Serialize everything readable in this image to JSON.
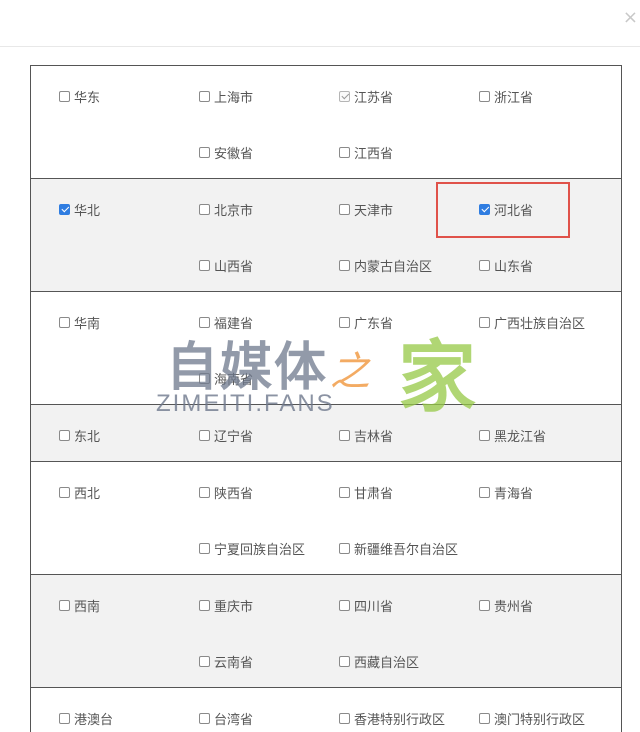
{
  "dialog": {
    "close_symbol": "×"
  },
  "regions": [
    {
      "name": "华东",
      "checked": false,
      "provinces": [
        {
          "label": "上海市",
          "state": "unchecked"
        },
        {
          "label": "江苏省",
          "state": "disabled-checked"
        },
        {
          "label": "浙江省",
          "state": "unchecked"
        },
        {
          "label": "安徽省",
          "state": "unchecked"
        },
        {
          "label": "江西省",
          "state": "unchecked"
        }
      ]
    },
    {
      "name": "华北",
      "checked": true,
      "provinces": [
        {
          "label": "北京市",
          "state": "unchecked"
        },
        {
          "label": "天津市",
          "state": "unchecked"
        },
        {
          "label": "河北省",
          "state": "checked"
        },
        {
          "label": "山西省",
          "state": "unchecked"
        },
        {
          "label": "内蒙古自治区",
          "state": "unchecked"
        },
        {
          "label": "山东省",
          "state": "unchecked"
        }
      ]
    },
    {
      "name": "华南",
      "checked": false,
      "provinces": [
        {
          "label": "福建省",
          "state": "unchecked"
        },
        {
          "label": "广东省",
          "state": "unchecked"
        },
        {
          "label": "广西壮族自治区",
          "state": "unchecked"
        },
        {
          "label": "海南省",
          "state": "unchecked"
        }
      ]
    },
    {
      "name": "东北",
      "checked": false,
      "provinces": [
        {
          "label": "辽宁省",
          "state": "unchecked"
        },
        {
          "label": "吉林省",
          "state": "unchecked"
        },
        {
          "label": "黑龙江省",
          "state": "unchecked"
        }
      ]
    },
    {
      "name": "西北",
      "checked": false,
      "provinces": [
        {
          "label": "陕西省",
          "state": "unchecked"
        },
        {
          "label": "甘肃省",
          "state": "unchecked"
        },
        {
          "label": "青海省",
          "state": "unchecked"
        },
        {
          "label": "宁夏回族自治区",
          "state": "unchecked"
        },
        {
          "label": "新疆维吾尔自治区",
          "state": "unchecked"
        }
      ]
    },
    {
      "name": "西南",
      "checked": false,
      "provinces": [
        {
          "label": "重庆市",
          "state": "unchecked"
        },
        {
          "label": "四川省",
          "state": "unchecked"
        },
        {
          "label": "贵州省",
          "state": "unchecked"
        },
        {
          "label": "云南省",
          "state": "unchecked"
        },
        {
          "label": "西藏自治区",
          "state": "unchecked"
        }
      ]
    },
    {
      "name": "港澳台",
      "checked": false,
      "provinces": [
        {
          "label": "台湾省",
          "state": "unchecked"
        },
        {
          "label": "香港特别行政区",
          "state": "unchecked"
        },
        {
          "label": "澳门特别行政区",
          "state": "unchecked"
        }
      ]
    }
  ],
  "annotation": {
    "highlight_color": "#e0524a"
  },
  "watermark": {
    "text_a": "自媒体",
    "text_b": "之",
    "text_c": "家",
    "text_d": "ZIMEITI.FANS"
  },
  "colors": {
    "checked_blue": "#2f7de1",
    "shaded_row": "#f2f2f2"
  }
}
